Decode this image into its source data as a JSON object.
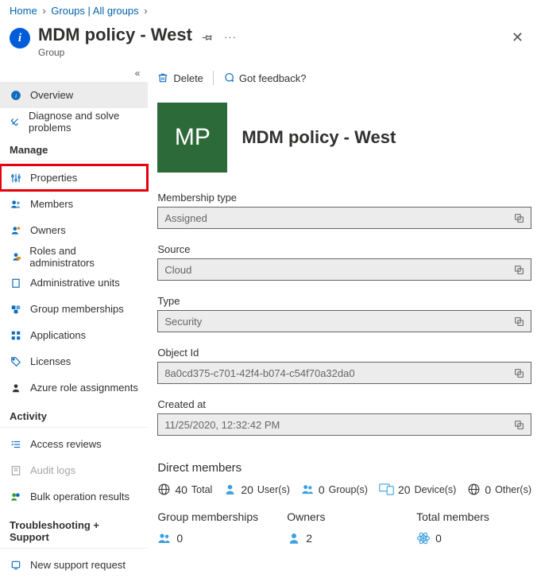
{
  "breadcrumb": [
    "Home",
    "Groups | All groups"
  ],
  "page": {
    "title": "MDM policy - West",
    "subtitle": "Group"
  },
  "sidebar": {
    "top": [
      {
        "label": "Overview"
      },
      {
        "label": "Diagnose and solve problems"
      }
    ],
    "sections": [
      {
        "title": "Manage",
        "items": [
          {
            "label": "Properties"
          },
          {
            "label": "Members"
          },
          {
            "label": "Owners"
          },
          {
            "label": "Roles and administrators"
          },
          {
            "label": "Administrative units"
          },
          {
            "label": "Group memberships"
          },
          {
            "label": "Applications"
          },
          {
            "label": "Licenses"
          },
          {
            "label": "Azure role assignments"
          }
        ]
      },
      {
        "title": "Activity",
        "items": [
          {
            "label": "Access reviews"
          },
          {
            "label": "Audit logs"
          },
          {
            "label": "Bulk operation results"
          }
        ]
      },
      {
        "title": "Troubleshooting + Support",
        "items": [
          {
            "label": "New support request"
          }
        ]
      }
    ]
  },
  "toolbar": {
    "delete": "Delete",
    "feedback": "Got feedback?"
  },
  "hero": {
    "initials": "MP",
    "title": "MDM policy - West"
  },
  "fields": {
    "membership_type": {
      "label": "Membership type",
      "value": "Assigned"
    },
    "source": {
      "label": "Source",
      "value": "Cloud"
    },
    "type": {
      "label": "Type",
      "value": "Security"
    },
    "object_id": {
      "label": "Object Id",
      "value": "8a0cd375-c701-42f4-b074-c54f70a32da0"
    },
    "created_at": {
      "label": "Created at",
      "value": "11/25/2020, 12:32:42 PM"
    }
  },
  "members": {
    "title": "Direct members",
    "total": {
      "n": "40",
      "l": "Total"
    },
    "users": {
      "n": "20",
      "l": "User(s)"
    },
    "groups": {
      "n": "0",
      "l": "Group(s)"
    },
    "devices": {
      "n": "20",
      "l": "Device(s)"
    },
    "others": {
      "n": "0",
      "l": "Other(s)"
    }
  },
  "footer": {
    "group_memberships": {
      "title": "Group memberships",
      "value": "0"
    },
    "owners": {
      "title": "Owners",
      "value": "2"
    },
    "total_members": {
      "title": "Total members",
      "value": "0"
    }
  }
}
